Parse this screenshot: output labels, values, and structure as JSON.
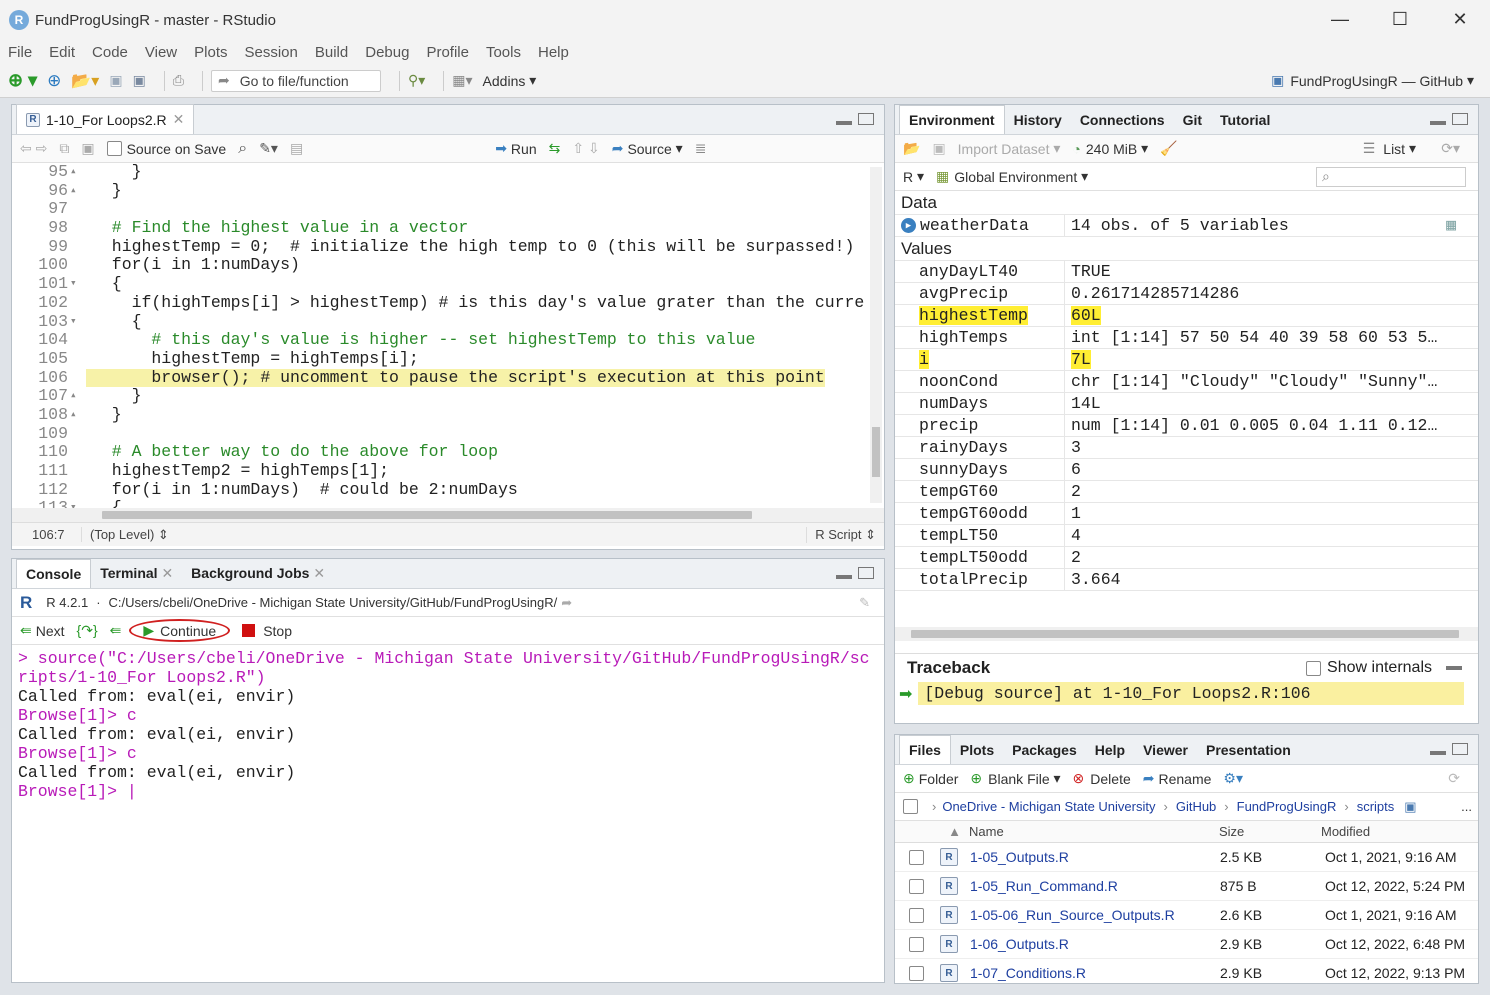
{
  "window": {
    "title": "FundProgUsingR - master - RStudio",
    "min": "—",
    "max": "☐",
    "close": "✕"
  },
  "menu": [
    "File",
    "Edit",
    "Code",
    "View",
    "Plots",
    "Session",
    "Build",
    "Debug",
    "Profile",
    "Tools",
    "Help"
  ],
  "toolbar": {
    "goto_placeholder": "Go to file/function",
    "addins": "Addins",
    "project": "FundProgUsingR — GitHub"
  },
  "editor": {
    "tab": "1-10_For Loops2.R",
    "source_on_save": "Source on Save",
    "run": "Run",
    "source": "Source",
    "lines": [
      {
        "n": "95",
        "f": "▴",
        "t": "    }"
      },
      {
        "n": "96",
        "f": "▴",
        "t": "  }"
      },
      {
        "n": "97",
        "f": "",
        "t": ""
      },
      {
        "n": "98",
        "f": "",
        "t": "  # Find the highest value in a vector"
      },
      {
        "n": "99",
        "f": "",
        "t": "  highestTemp = 0;  # initialize the high temp to 0 (this will be surpassed!)"
      },
      {
        "n": "100",
        "f": "",
        "t": "  for(i in 1:numDays)"
      },
      {
        "n": "101",
        "f": "▾",
        "t": "  {"
      },
      {
        "n": "102",
        "f": "",
        "t": "    if(highTemps[i] > highestTemp) # is this day's value grater than the curre"
      },
      {
        "n": "103",
        "f": "▾",
        "t": "    {"
      },
      {
        "n": "104",
        "f": "",
        "t": "      # this day's value is higher -- set highestTemp to this value"
      },
      {
        "n": "105",
        "f": "",
        "t": "      highestTemp = highTemps[i];"
      },
      {
        "n": "106",
        "f": "",
        "t": "      browser(); # uncomment to pause the script's execution at this point"
      },
      {
        "n": "107",
        "f": "▴",
        "t": "    }"
      },
      {
        "n": "108",
        "f": "▴",
        "t": "  }"
      },
      {
        "n": "109",
        "f": "",
        "t": ""
      },
      {
        "n": "110",
        "f": "",
        "t": "  # A better way to do the above for loop"
      },
      {
        "n": "111",
        "f": "",
        "t": "  highestTemp2 = highTemps[1];"
      },
      {
        "n": "112",
        "f": "",
        "t": "  for(i in 1:numDays)  # could be 2:numDays"
      },
      {
        "n": "113",
        "f": "▾",
        "t": "  {"
      },
      {
        "n": "114",
        "f": "",
        "t": ""
      }
    ],
    "status_pos": "106:7",
    "status_level": "(Top Level)",
    "status_type": "R Script"
  },
  "console": {
    "tabs": [
      "Console",
      "Terminal",
      "Background Jobs"
    ],
    "version": "R 4.2.1",
    "path": "C:/Users/cbeli/OneDrive - Michigan State University/GitHub/FundProgUsingR/",
    "next": "Next",
    "continue": "Continue",
    "stop": "Stop",
    "output": [
      {
        "c": "pur",
        "t": "> source(\"C:/Users/cbeli/OneDrive - Michigan State University/GitHub/FundProgUsingR/sc"
      },
      {
        "c": "pur",
        "t": "ripts/1-10_For Loops2.R\")"
      },
      {
        "c": "blk",
        "t": "Called from: eval(ei, envir)"
      },
      {
        "c": "pur",
        "t": "Browse[1]> c"
      },
      {
        "c": "blk",
        "t": "Called from: eval(ei, envir)"
      },
      {
        "c": "pur",
        "t": "Browse[1]> c"
      },
      {
        "c": "blk",
        "t": "Called from: eval(ei, envir)"
      },
      {
        "c": "pur",
        "t": "Browse[1]> |"
      }
    ]
  },
  "environment": {
    "tabs": [
      "Environment",
      "History",
      "Connections",
      "Git",
      "Tutorial"
    ],
    "import_dataset": "Import Dataset",
    "memory": "240 MiB",
    "list": "List",
    "lang": "R",
    "scope": "Global Environment",
    "data_header": "Data",
    "data": [
      {
        "name": "weatherData",
        "value": "14 obs. of 5 variables"
      }
    ],
    "values_header": "Values",
    "values": [
      {
        "name": "anyDayLT40",
        "value": "TRUE",
        "hl": false
      },
      {
        "name": "avgPrecip",
        "value": "0.261714285714286",
        "hl": false
      },
      {
        "name": "highestTemp",
        "value": "60L",
        "hl": true
      },
      {
        "name": "highTemps",
        "value": "int [1:14] 57 50 54 40 39 58 60 53 5…",
        "hl": false
      },
      {
        "name": "i",
        "value": "7L",
        "hl": true
      },
      {
        "name": "noonCond",
        "value": "chr [1:14] \"Cloudy\" \"Cloudy\" \"Sunny\"…",
        "hl": false
      },
      {
        "name": "numDays",
        "value": "14L",
        "hl": false
      },
      {
        "name": "precip",
        "value": "num [1:14] 0.01 0.005 0.04 1.11 0.12…",
        "hl": false
      },
      {
        "name": "rainyDays",
        "value": "3",
        "hl": false
      },
      {
        "name": "sunnyDays",
        "value": "6",
        "hl": false
      },
      {
        "name": "tempGT60",
        "value": "2",
        "hl": false
      },
      {
        "name": "tempGT60odd",
        "value": "1",
        "hl": false
      },
      {
        "name": "tempLT50",
        "value": "4",
        "hl": false
      },
      {
        "name": "tempLT50odd",
        "value": "2",
        "hl": false
      },
      {
        "name": "totalPrecip",
        "value": "3.664",
        "hl": false
      }
    ]
  },
  "traceback": {
    "title": "Traceback",
    "show_internals": "Show internals",
    "entry": "[Debug source] at 1-10_For Loops2.R:106"
  },
  "files": {
    "tabs": [
      "Files",
      "Plots",
      "Packages",
      "Help",
      "Viewer",
      "Presentation"
    ],
    "folder": "Folder",
    "blank_file": "Blank File",
    "delete": "Delete",
    "rename": "Rename",
    "breadcrumb": [
      "OneDrive - Michigan State University",
      "GitHub",
      "FundProgUsingR",
      "scripts"
    ],
    "more": "...",
    "columns": [
      "Name",
      "Size",
      "Modified"
    ],
    "rows": [
      {
        "name": "1-05_Outputs.R",
        "size": "2.5 KB",
        "modified": "Oct 1, 2021, 9:16 AM"
      },
      {
        "name": "1-05_Run_Command.R",
        "size": "875 B",
        "modified": "Oct 12, 2022, 5:24 PM"
      },
      {
        "name": "1-05-06_Run_Source_Outputs.R",
        "size": "2.6 KB",
        "modified": "Oct 1, 2021, 9:16 AM"
      },
      {
        "name": "1-06_Outputs.R",
        "size": "2.9 KB",
        "modified": "Oct 12, 2022, 6:48 PM"
      },
      {
        "name": "1-07_Conditions.R",
        "size": "2.9 KB",
        "modified": "Oct 12, 2022, 9:13 PM"
      }
    ]
  }
}
